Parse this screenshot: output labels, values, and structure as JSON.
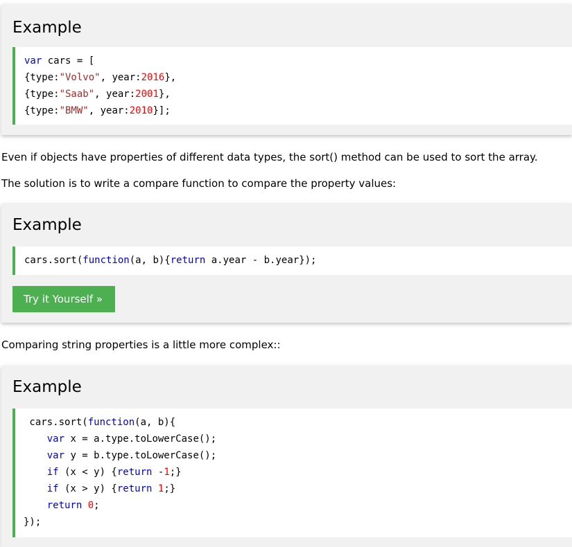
{
  "example1": {
    "heading": "Example",
    "code": [
      [
        {
          "t": "var",
          "c": "kw"
        },
        {
          "t": " cars = ["
        }
      ],
      [
        {
          "t": "{type:"
        },
        {
          "t": "\"Volvo\"",
          "c": "str"
        },
        {
          "t": ", year:"
        },
        {
          "t": "2016",
          "c": "num"
        },
        {
          "t": "},"
        }
      ],
      [
        {
          "t": "{type:"
        },
        {
          "t": "\"Saab\"",
          "c": "str"
        },
        {
          "t": ", year:"
        },
        {
          "t": "2001",
          "c": "num"
        },
        {
          "t": "},"
        }
      ],
      [
        {
          "t": "{type:"
        },
        {
          "t": "\"BMW\"",
          "c": "str"
        },
        {
          "t": ", year:"
        },
        {
          "t": "2010",
          "c": "num"
        },
        {
          "t": "}];"
        }
      ]
    ]
  },
  "paragraph1": "Even if objects have properties of different data types, the sort() method can be used to sort the array.",
  "paragraph2": "The solution is to write a compare function to compare the property values:",
  "example2": {
    "heading": "Example",
    "code": [
      [
        {
          "t": "cars.sort("
        },
        {
          "t": "function",
          "c": "kw"
        },
        {
          "t": "(a, b){"
        },
        {
          "t": "return",
          "c": "kw"
        },
        {
          "t": " a.year - b.year});"
        }
      ]
    ],
    "button_label": "Try it Yourself »"
  },
  "paragraph3": "Comparing string properties is a little more complex::",
  "example3": {
    "heading": "Example",
    "code": [
      [
        {
          "t": " cars.sort("
        },
        {
          "t": "function",
          "c": "kw"
        },
        {
          "t": "(a, b){"
        }
      ],
      [
        {
          "t": "    "
        },
        {
          "t": "var",
          "c": "kw"
        },
        {
          "t": " x = a.type.toLowerCase();"
        }
      ],
      [
        {
          "t": "    "
        },
        {
          "t": "var",
          "c": "kw"
        },
        {
          "t": " y = b.type.toLowerCase();"
        }
      ],
      [
        {
          "t": "    "
        },
        {
          "t": "if",
          "c": "kw"
        },
        {
          "t": " (x < y) {"
        },
        {
          "t": "return",
          "c": "kw"
        },
        {
          "t": " -"
        },
        {
          "t": "1",
          "c": "num"
        },
        {
          "t": ";}"
        }
      ],
      [
        {
          "t": "    "
        },
        {
          "t": "if",
          "c": "kw"
        },
        {
          "t": " (x > y) {"
        },
        {
          "t": "return",
          "c": "kw"
        },
        {
          "t": " "
        },
        {
          "t": "1",
          "c": "num"
        },
        {
          "t": ";}"
        }
      ],
      [
        {
          "t": "    "
        },
        {
          "t": "return",
          "c": "kw"
        },
        {
          "t": " "
        },
        {
          "t": "0",
          "c": "num"
        },
        {
          "t": ";"
        }
      ],
      [
        {
          "t": "});"
        }
      ]
    ]
  },
  "colors": {
    "accent_green": "#4caf50",
    "panel_bg": "#f1f1f1",
    "keyword": "#0000cd",
    "string": "#a52a2a",
    "number": "#ff0000"
  }
}
